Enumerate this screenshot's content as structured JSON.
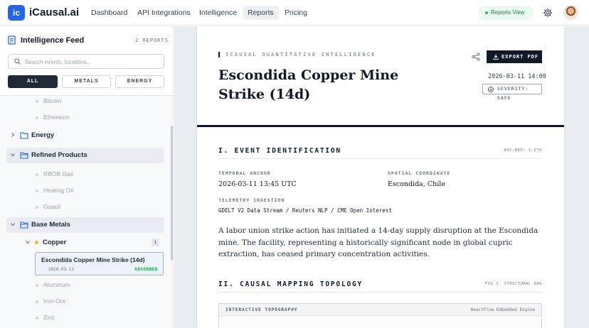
{
  "app": {
    "logo_text": "ic",
    "name": "iCausal.ai"
  },
  "nav": {
    "items": [
      {
        "label": "Dashboard"
      },
      {
        "label": "API Integrations"
      },
      {
        "label": "Intelligence"
      },
      {
        "label": "Reports",
        "active": true
      },
      {
        "label": "Pricing"
      }
    ],
    "status_badge": "Reports View",
    "settings_icon": "gear-icon",
    "avatar_icon": "user-avatar"
  },
  "sidebar": {
    "title": "Intelligence Feed",
    "count": "2 REPORTS",
    "search": {
      "placeholder": "Search events, locations...",
      "value": ""
    },
    "filters": [
      {
        "label": "ALL",
        "active": true
      },
      {
        "label": "METALS",
        "active": false
      },
      {
        "label": "ENERGY",
        "active": false
      }
    ],
    "tree": {
      "crypto_leaves": [
        "Bitcoin",
        "Ethereum"
      ],
      "energy": {
        "label": "Energy",
        "expanded": false
      },
      "refined": {
        "label": "Refined Products",
        "expanded": true,
        "leaves": [
          "RBOB Gas",
          "Heating Oil",
          "Gasoil"
        ]
      },
      "base_metals": {
        "label": "Base Metals",
        "expanded": true
      },
      "copper": {
        "label": "Copper",
        "count": "1"
      },
      "event": {
        "title": "Escondida Copper Mine Strike (14d)",
        "date": "2026-03-11",
        "status": "ABSORBED"
      },
      "metal_leaves": [
        "Aluminum",
        "Iron Ore",
        "Zinc"
      ]
    }
  },
  "report": {
    "kicker": "ICAUSAL QUANTITATIVE INTELLIGENCE",
    "export_label": "EXPORT PDF",
    "title": "Escondida Copper Mine Strike (14d)",
    "datetime": "2026-03-11 14:00",
    "severity": "SEVERITY: SAFE",
    "section1": {
      "heading": "I. EVENT IDENTIFICATION",
      "ref": "DOC-REF: 1-CTX",
      "temporal_label": "TEMPORAL ANCHOR",
      "temporal_value": "2026-03-11 13:45 UTC",
      "spatial_label": "SPATIAL COORDINATE",
      "spatial_value": "Escondida, Chile",
      "telemetry_label": "TELEMETRY INGESTION",
      "telemetry_value": "GDELT V2 Data Stream / Reuters NLP / CME Open Interest",
      "body": "A labor union strike action has initiated a 14-day supply disruption at the Escondida mine. The facility, representing a historically significant node in global cupric extraction, has ceased primary concentration activities."
    },
    "section2": {
      "heading": "II. CAUSAL MAPPING TOPOLOGY",
      "ref": "FIG 1. STRUCTURAL DAG",
      "panel_label": "INTERACTIVE TOPOGRAPHY",
      "panel_engine": "ReactFlow Embedded Engine"
    }
  },
  "colors": {
    "brand": "#2563eb",
    "dark": "#111827",
    "status_green": "#16a34a",
    "copper_dot": "#f5b731"
  }
}
